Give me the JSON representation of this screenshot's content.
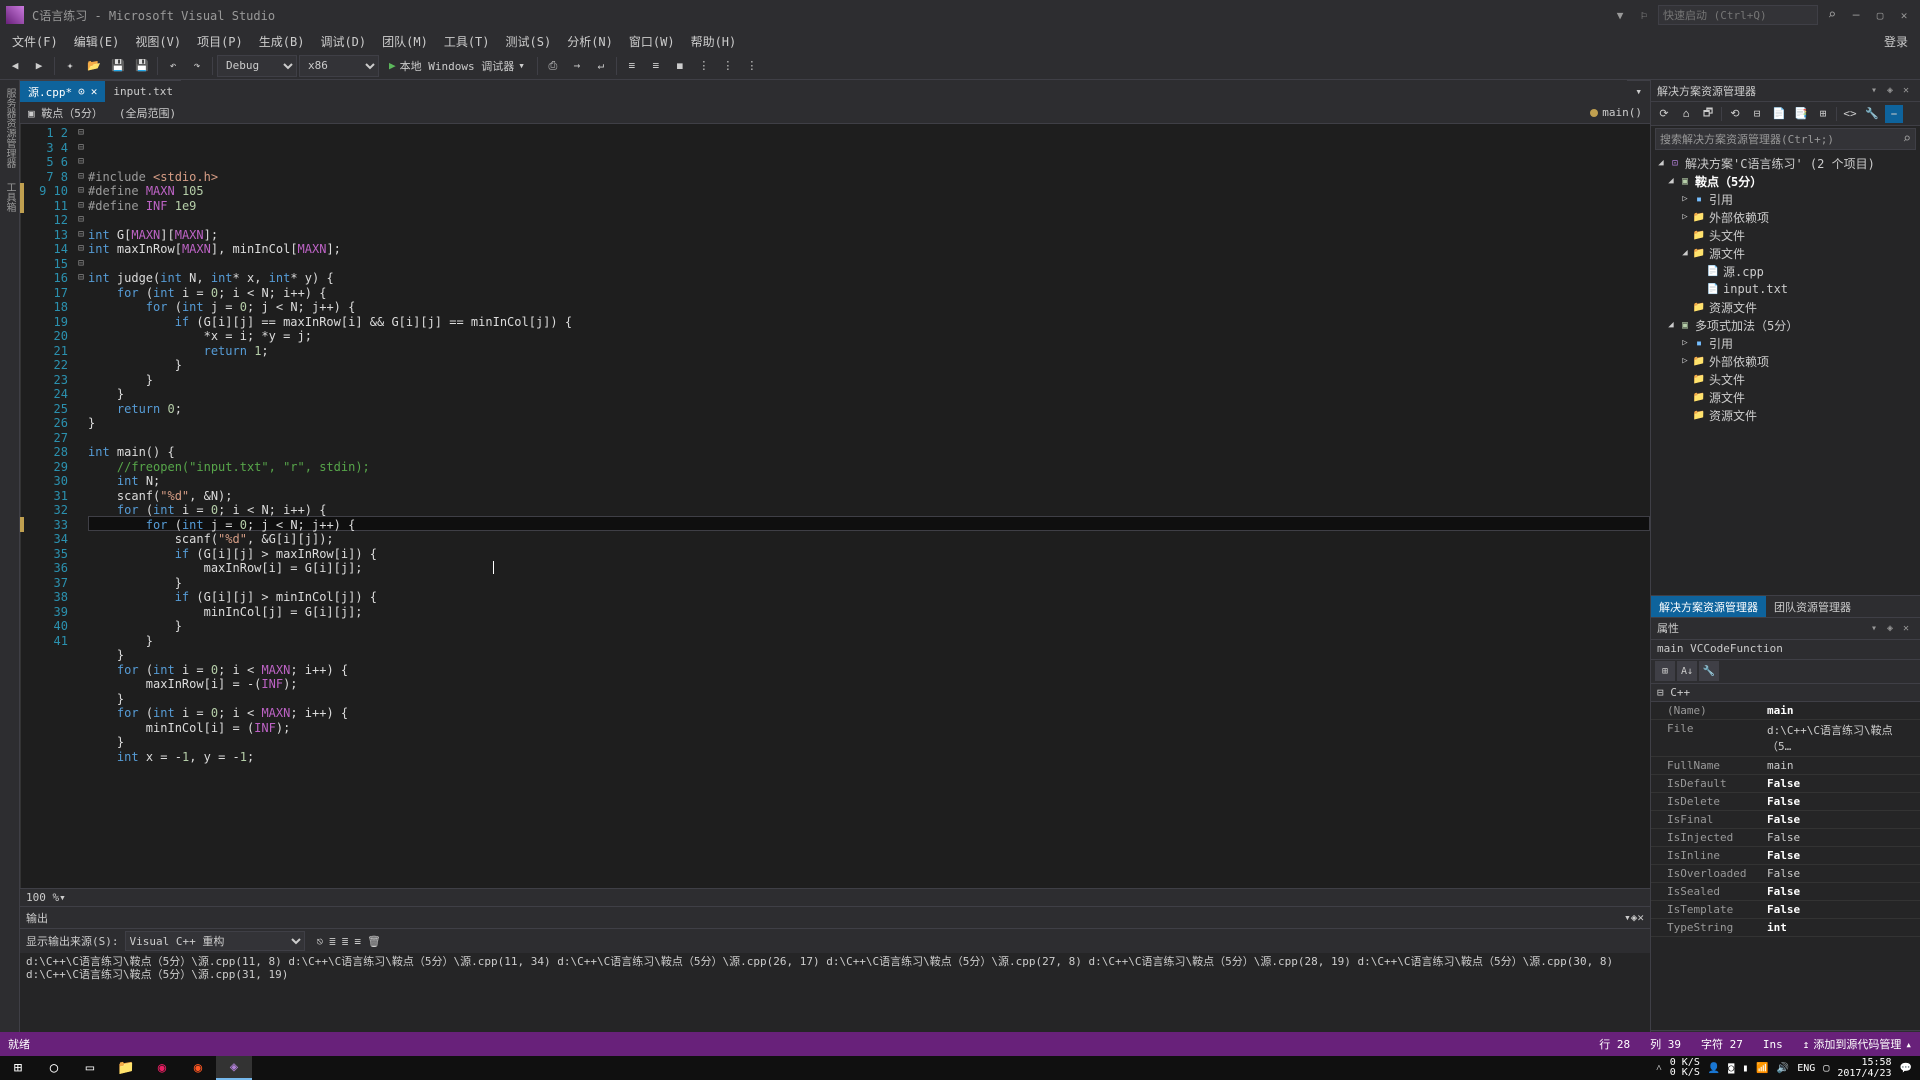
{
  "title": "C语言练习 - Microsoft Visual Studio",
  "quicklaunch_placeholder": "快速启动 (Ctrl+Q)",
  "menu": [
    "文件(F)",
    "编辑(E)",
    "视图(V)",
    "项目(P)",
    "生成(B)",
    "调试(D)",
    "团队(M)",
    "工具(T)",
    "测试(S)",
    "分析(N)",
    "窗口(W)",
    "帮助(H)"
  ],
  "menu_login": "登录",
  "toolbar": {
    "config": "Debug",
    "platform": "x86",
    "debug_label": "本地 Windows 调试器"
  },
  "tabs": [
    {
      "name": "源.cpp*",
      "active": true
    },
    {
      "name": "input.txt",
      "active": false
    }
  ],
  "crumb": "鞍点（5分）",
  "scope_combo": "(全局范围)",
  "func": "main()",
  "zoom": "100 %",
  "code_lines_count": 41,
  "output": {
    "title": "输出",
    "source_label": "显示输出来源(S):",
    "source_value": "Visual C++ 重构",
    "lines": [
      "d:\\C++\\C语言练习\\鞍点（5分）\\源.cpp(11, 8)",
      "d:\\C++\\C语言练习\\鞍点（5分）\\源.cpp(11, 34)",
      "d:\\C++\\C语言练习\\鞍点（5分）\\源.cpp(26, 17)",
      "d:\\C++\\C语言练习\\鞍点（5分）\\源.cpp(27, 8)",
      "d:\\C++\\C语言练习\\鞍点（5分）\\源.cpp(28, 19)",
      "d:\\C++\\C语言练习\\鞍点（5分）\\源.cpp(30, 8)",
      "d:\\C++\\C语言练习\\鞍点（5分）\\源.cpp(31, 19)"
    ]
  },
  "explorer": {
    "title": "解决方案资源管理器",
    "search_placeholder": "搜索解决方案资源管理器(Ctrl+;)",
    "root": "解决方案'C语言练习' (2 个项目)",
    "projects": [
      {
        "name": "鞍点（5分）",
        "bold": true,
        "items": [
          "引用",
          "外部依赖项",
          "头文件",
          {
            "name": "源文件",
            "children": [
              "源.cpp",
              "input.txt"
            ]
          },
          "资源文件"
        ]
      },
      {
        "name": "多项式加法（5分）",
        "bold": false,
        "items": [
          "引用",
          "外部依赖项",
          "头文件",
          "源文件",
          "资源文件"
        ]
      }
    ],
    "bottom_tabs": [
      "解决方案资源管理器",
      "团队资源管理器"
    ]
  },
  "properties": {
    "title": "属性",
    "subtitle": "main VCCodeFunction",
    "category": "C++",
    "rows": [
      {
        "k": "(Name)",
        "v": "main",
        "bold": true
      },
      {
        "k": "File",
        "v": "d:\\C++\\C语言练习\\鞍点（5…"
      },
      {
        "k": "FullName",
        "v": "main"
      },
      {
        "k": "IsDefault",
        "v": "False",
        "bold": true
      },
      {
        "k": "IsDelete",
        "v": "False",
        "bold": true
      },
      {
        "k": "IsFinal",
        "v": "False",
        "bold": true
      },
      {
        "k": "IsInjected",
        "v": "False"
      },
      {
        "k": "IsInline",
        "v": "False",
        "bold": true
      },
      {
        "k": "IsOverloaded",
        "v": "False"
      },
      {
        "k": "IsSealed",
        "v": "False",
        "bold": true
      },
      {
        "k": "IsTemplate",
        "v": "False",
        "bold": true
      },
      {
        "k": "TypeString",
        "v": "int",
        "bold": true
      }
    ],
    "desc": "C++"
  },
  "status": {
    "ready": "就绪",
    "line": "行 28",
    "col": "列 39",
    "ch": "字符 27",
    "ins": "Ins",
    "src_ctrl": "添加到源代码管理"
  },
  "tray": {
    "net_up": "0 K/S",
    "net_dn": "0 K/S",
    "lang": "ENG",
    "time": "15:58",
    "date": "2017/4/23"
  }
}
